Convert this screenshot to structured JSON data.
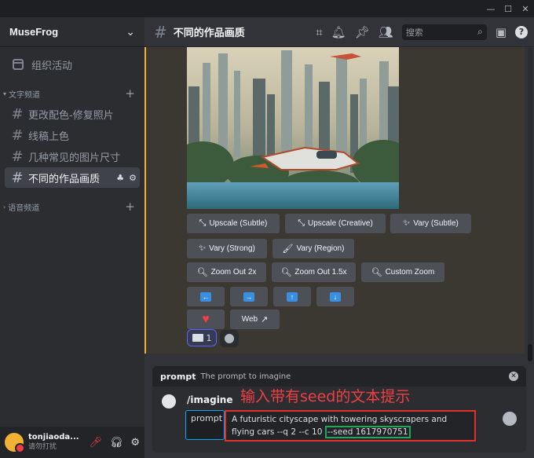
{
  "window": {
    "minimize": "—",
    "maximize": "☐",
    "close": "✕"
  },
  "server": {
    "name": "MuseFrog"
  },
  "sidebar": {
    "events_label": "组织活动",
    "text_category": "文字频道",
    "voice_category": "语音频道",
    "channels": [
      {
        "name": "更改配色-修复照片"
      },
      {
        "name": "线稿上色"
      },
      {
        "name": "几种常见的图片尺寸"
      },
      {
        "name": "不同的作品画质",
        "active": true
      }
    ]
  },
  "user": {
    "name": "tonjiaoda...",
    "status": "请勿打扰"
  },
  "header": {
    "channel": "不同的作品画质",
    "search_placeholder": "搜索"
  },
  "buttons": {
    "row1": [
      "Upscale (Subtle)",
      "Upscale (Creative)",
      "Vary (Subtle)"
    ],
    "row2": [
      "Vary (Strong)",
      "Vary (Region)"
    ],
    "row3": [
      "Zoom Out 2x",
      "Zoom Out 1.5x",
      "Custom Zoom"
    ],
    "arrows": [
      "←",
      "→",
      "↑",
      "↓"
    ],
    "web": "Web",
    "web_icon": "↗"
  },
  "reaction": {
    "count": "1"
  },
  "composer": {
    "option_name": "prompt",
    "option_desc": "The prompt to imagine",
    "command": "/imagine",
    "annotation": "输入带有seed的文本提示",
    "param_label": "prompt",
    "prompt_text": "A futuristic cityscape with towering skyscrapers and flying cars --q 2 --c 10 ",
    "seed_text": "--seed 1617970751"
  },
  "colors": {
    "accent": "#5865f2",
    "highlight_border": "#f0b232",
    "annotation": "#e0312c",
    "seed_box": "#23a55a"
  }
}
